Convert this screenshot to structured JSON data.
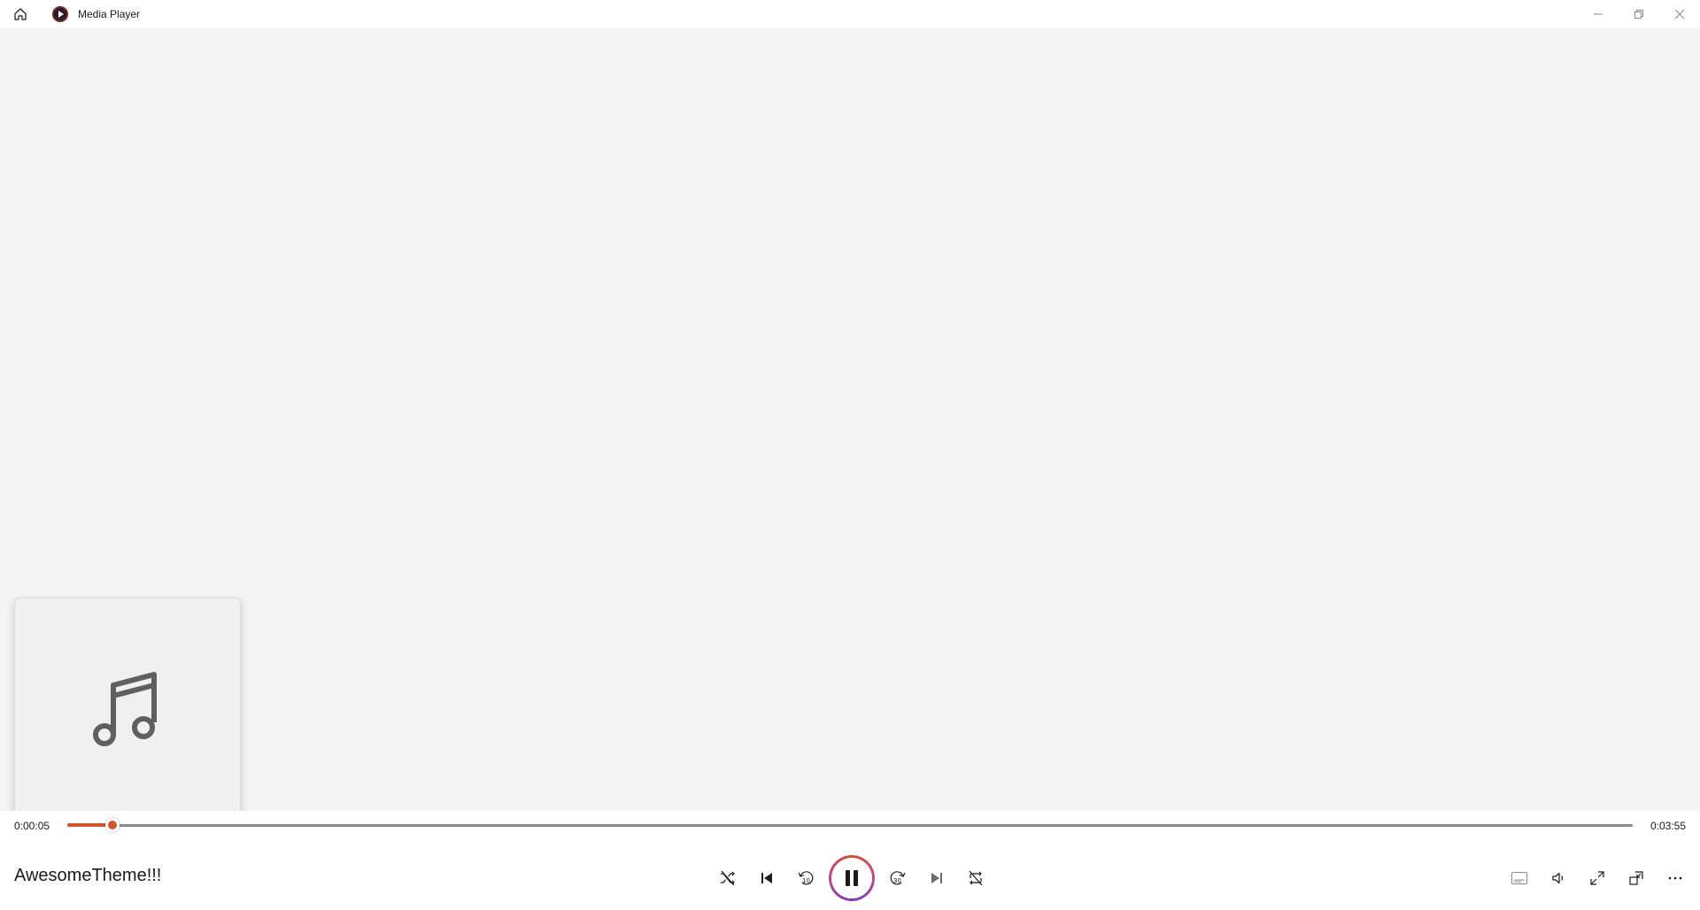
{
  "titlebar": {
    "app_title": "Media Player",
    "icons": {
      "home": "home-icon",
      "app": "media-player-app-icon",
      "minimize": "minimize-icon",
      "restore": "restore-icon",
      "close": "close-icon"
    }
  },
  "main": {
    "album_art": {
      "icon": "music-note-icon"
    }
  },
  "playback": {
    "current_time": "0:00:05",
    "total_time": "0:03:55",
    "progress_fraction": 0.029,
    "song_title": "AwesomeTheme!!!",
    "state": "playing"
  },
  "controls": {
    "shuffle": "shuffle-icon",
    "previous": "previous-icon",
    "rewind": "rewind-10-icon",
    "rewind_label": "10",
    "play_pause": "pause-icon",
    "forward": "forward-30-icon",
    "forward_label": "30",
    "next": "next-icon",
    "repeat": "repeat-off-icon"
  },
  "right_controls": {
    "captions": "captions-icon",
    "volume": "volume-icon",
    "fullscreen": "fullscreen-icon",
    "mini_player": "mini-player-icon",
    "more": "more-icon"
  },
  "colors": {
    "accent": "#d35230",
    "background": "#f4f4f4",
    "bar": "#ffffff"
  }
}
